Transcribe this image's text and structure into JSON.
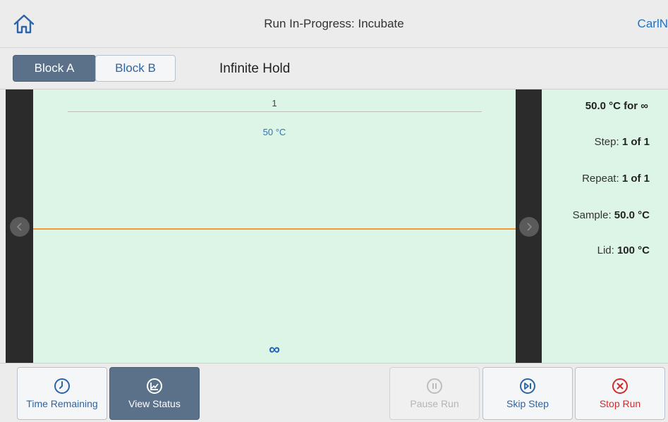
{
  "header": {
    "title": "Run In-Progress: Incubate",
    "user": "CarlN",
    "home_icon": "home-icon"
  },
  "tabs": [
    {
      "label": "Block A",
      "active": true
    },
    {
      "label": "Block B",
      "active": false
    }
  ],
  "protocol": {
    "title": "Infinite Hold"
  },
  "graph": {
    "step_number": "1",
    "temperature_label": "50 °C",
    "hold_symbol": "∞",
    "hold_line_color": "#f29a3a",
    "background_color": "#dcf5e6"
  },
  "status": {
    "summary": "50.0 °C for ∞",
    "step_label": "Step:",
    "step_value": "1 of 1",
    "repeat_label": "Repeat:",
    "repeat_value": "1 of 1",
    "sample_label": "Sample:",
    "sample_value": "50.0 °C",
    "lid_label": "Lid:",
    "lid_value": "100 °C"
  },
  "toolbar": {
    "time_remaining": "Time Remaining",
    "view_status": "View Status",
    "pause_run": "Pause Run",
    "skip_step": "Skip Step",
    "stop_run": "Stop Run"
  },
  "colors": {
    "accent": "#2b64a8",
    "active_tab": "#5a7189",
    "stop": "#d42a2a"
  }
}
